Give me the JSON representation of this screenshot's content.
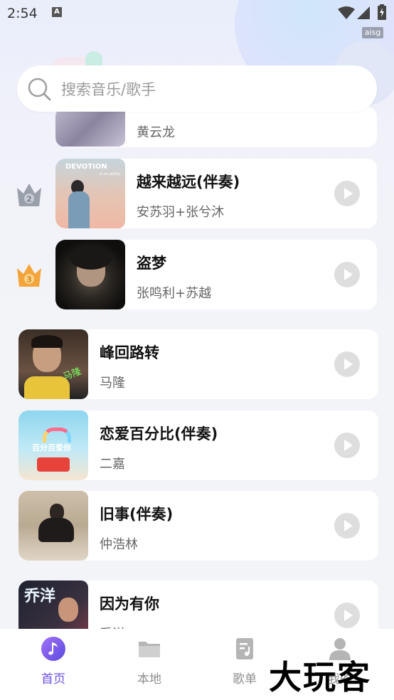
{
  "status_bar": {
    "time": "2:54",
    "a_icon": "A",
    "badge": "aisg"
  },
  "search": {
    "placeholder": "搜索音乐/歌手"
  },
  "ranked": [
    {
      "rank": "2",
      "title": "越来越远(伴奏)",
      "artist": "安苏羽+张兮沐",
      "cover_text": "DEVOTION",
      "cover_sub": "in an ability"
    },
    {
      "rank": "3",
      "title": "盗梦",
      "artist": "张鸣利+苏越"
    }
  ],
  "partial_top": {
    "artist": "黄云龙"
  },
  "songs": [
    {
      "title": "峰回路转",
      "artist": "马隆",
      "cover_text": "马隆"
    },
    {
      "title": "恋爱百分比(伴奏)",
      "artist": "二嘉",
      "cover_text": "百分百爱你"
    },
    {
      "title": "旧事(伴奏)",
      "artist": "仲浩林"
    },
    {
      "title": "因为有你",
      "artist": "乔洋",
      "cover_text": "乔洋"
    }
  ],
  "nav": {
    "home": "首页",
    "local": "本地",
    "playlist": "歌单",
    "mine": "我的"
  },
  "watermark": "大玩客",
  "colors": {
    "accent": "#6c4fe4",
    "crown_silver": "#9aa0aa",
    "crown_gold": "#f3a43a"
  }
}
